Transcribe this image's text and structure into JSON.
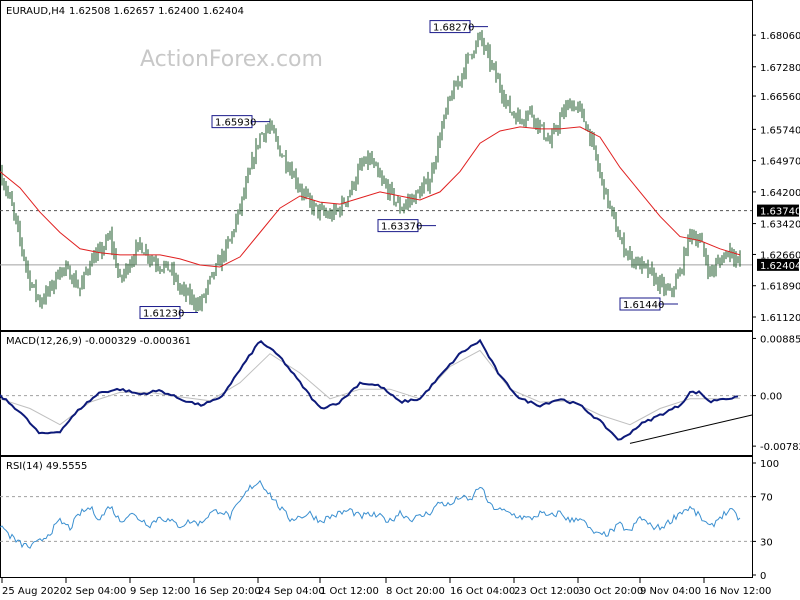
{
  "header": {
    "title": "EURAUD,H4",
    "ohlc": "1.62508 1.62657 1.62400 1.62404"
  },
  "watermark": "ActionForex.com",
  "colors": {
    "price": "#1e5a28",
    "ma": "#e02020",
    "macd": "#0d1a7a",
    "signal": "#c0c0c0",
    "rsi": "#3a8fd0",
    "callout_border": "#1a1a8a",
    "hline": "#555555",
    "trendline": "#000000"
  },
  "chart_data": [
    {
      "type": "candlestick",
      "name": "price",
      "title": "EURAUD,H4",
      "ylim": [
        1.608,
        1.689
      ],
      "yticks": [
        "1.68060",
        "1.67280",
        "1.66560",
        "1.65740",
        "1.64970",
        "1.64200",
        "1.63420",
        "1.62660",
        "1.61890",
        "1.61120"
      ],
      "ytick_values": [
        1.6806,
        1.6728,
        1.6656,
        1.6574,
        1.6497,
        1.642,
        1.6342,
        1.6266,
        1.6189,
        1.6112
      ],
      "xticks": [
        "25 Aug 2020",
        "2 Sep 04:00",
        "9 Sep 12:00",
        "16 Sep 20:00",
        "24 Sep 04:00",
        "1 Oct 12:00",
        "8 Oct 20:00",
        "16 Oct 04:00",
        "23 Oct 12:00",
        "30 Oct 20:00",
        "9 Nov 04:00",
        "16 Nov 12:00"
      ],
      "level_line": {
        "value": 1.6374,
        "label": "1.63740"
      },
      "current_price": {
        "value": 1.62404,
        "label": "1.62404"
      },
      "callouts": [
        {
          "label": "1.68270",
          "value": 1.6827
        },
        {
          "label": "1.65930",
          "value": 1.6593
        },
        {
          "label": "1.63370",
          "value": 1.6337
        },
        {
          "label": "1.61230",
          "value": 1.6123
        },
        {
          "label": "1.61440",
          "value": 1.6144
        }
      ],
      "close_path": [
        [
          0,
          1.647
        ],
        [
          10,
          1.64
        ],
        [
          20,
          1.63
        ],
        [
          30,
          1.62
        ],
        [
          40,
          1.615
        ],
        [
          50,
          1.618
        ],
        [
          60,
          1.623
        ],
        [
          70,
          1.622
        ],
        [
          80,
          1.618
        ],
        [
          90,
          1.625
        ],
        [
          100,
          1.627
        ],
        [
          110,
          1.631
        ],
        [
          120,
          1.62
        ],
        [
          130,
          1.625
        ],
        [
          140,
          1.629
        ],
        [
          150,
          1.626
        ],
        [
          160,
          1.624
        ],
        [
          170,
          1.623
        ],
        [
          180,
          1.618
        ],
        [
          190,
          1.616
        ],
        [
          200,
          1.614
        ],
        [
          210,
          1.62
        ],
        [
          220,
          1.625
        ],
        [
          230,
          1.63
        ],
        [
          240,
          1.638
        ],
        [
          250,
          1.647
        ],
        [
          260,
          1.656
        ],
        [
          270,
          1.658
        ],
        [
          280,
          1.652
        ],
        [
          290,
          1.648
        ],
        [
          300,
          1.643
        ],
        [
          310,
          1.639
        ],
        [
          320,
          1.637
        ],
        [
          330,
          1.636
        ],
        [
          340,
          1.638
        ],
        [
          350,
          1.642
        ],
        [
          360,
          1.648
        ],
        [
          370,
          1.65
        ],
        [
          380,
          1.645
        ],
        [
          390,
          1.642
        ],
        [
          400,
          1.638
        ],
        [
          410,
          1.64
        ],
        [
          420,
          1.642
        ],
        [
          430,
          1.645
        ],
        [
          440,
          1.656
        ],
        [
          450,
          1.665
        ],
        [
          460,
          1.67
        ],
        [
          470,
          1.676
        ],
        [
          480,
          1.68
        ],
        [
          490,
          1.674
        ],
        [
          500,
          1.668
        ],
        [
          510,
          1.662
        ],
        [
          520,
          1.66
        ],
        [
          530,
          1.662
        ],
        [
          540,
          1.658
        ],
        [
          550,
          1.654
        ],
        [
          560,
          1.66
        ],
        [
          570,
          1.664
        ],
        [
          580,
          1.662
        ],
        [
          590,
          1.656
        ],
        [
          600,
          1.646
        ],
        [
          610,
          1.638
        ],
        [
          620,
          1.63
        ],
        [
          630,
          1.626
        ],
        [
          640,
          1.624
        ],
        [
          650,
          1.622
        ],
        [
          660,
          1.619
        ],
        [
          670,
          1.617
        ],
        [
          680,
          1.622
        ],
        [
          690,
          1.632
        ],
        [
          700,
          1.63
        ],
        [
          710,
          1.622
        ],
        [
          720,
          1.625
        ],
        [
          730,
          1.628
        ],
        [
          740,
          1.624
        ]
      ],
      "ma_path": [
        [
          0,
          1.647
        ],
        [
          20,
          1.643
        ],
        [
          40,
          1.637
        ],
        [
          60,
          1.632
        ],
        [
          80,
          1.628
        ],
        [
          100,
          1.627
        ],
        [
          120,
          1.6265
        ],
        [
          140,
          1.6265
        ],
        [
          160,
          1.6265
        ],
        [
          180,
          1.6255
        ],
        [
          200,
          1.624
        ],
        [
          220,
          1.6235
        ],
        [
          240,
          1.626
        ],
        [
          260,
          1.632
        ],
        [
          280,
          1.638
        ],
        [
          300,
          1.641
        ],
        [
          320,
          1.6395
        ],
        [
          340,
          1.639
        ],
        [
          360,
          1.6405
        ],
        [
          380,
          1.642
        ],
        [
          400,
          1.641
        ],
        [
          420,
          1.64
        ],
        [
          440,
          1.642
        ],
        [
          460,
          1.647
        ],
        [
          480,
          1.654
        ],
        [
          500,
          1.657
        ],
        [
          520,
          1.658
        ],
        [
          540,
          1.6575
        ],
        [
          560,
          1.6575
        ],
        [
          580,
          1.658
        ],
        [
          600,
          1.6555
        ],
        [
          620,
          1.648
        ],
        [
          640,
          1.642
        ],
        [
          660,
          1.636
        ],
        [
          680,
          1.631
        ],
        [
          700,
          1.63
        ],
        [
          720,
          1.628
        ],
        [
          740,
          1.6265
        ]
      ]
    },
    {
      "type": "line",
      "name": "macd",
      "title": "MACD(12,26,9) -0.000329 -0.000361",
      "ylim": [
        -0.0092,
        0.0097
      ],
      "yticks": [
        "0.008859",
        "0.00",
        "-0.007826"
      ],
      "ytick_values": [
        0.008859,
        0.0,
        -0.007826
      ],
      "series": [
        {
          "values_path": [
            [
              0,
              0.0
            ],
            [
              20,
              -0.0025
            ],
            [
              40,
              -0.006
            ],
            [
              60,
              -0.0055
            ],
            [
              80,
              -0.002
            ],
            [
              100,
              0.0005
            ],
            [
              120,
              0.001
            ],
            [
              140,
              0.0002
            ],
            [
              160,
              0.0008
            ],
            [
              180,
              -0.0005
            ],
            [
              200,
              -0.0015
            ],
            [
              220,
              -0.0005
            ],
            [
              240,
              0.004
            ],
            [
              260,
              0.0085
            ],
            [
              280,
              0.006
            ],
            [
              300,
              0.002
            ],
            [
              320,
              -0.002
            ],
            [
              340,
              -0.001
            ],
            [
              360,
              0.002
            ],
            [
              380,
              0.0015
            ],
            [
              400,
              -0.001
            ],
            [
              420,
              -0.0005
            ],
            [
              440,
              0.003
            ],
            [
              460,
              0.0065
            ],
            [
              480,
              0.0085
            ],
            [
              500,
              0.003
            ],
            [
              520,
              -0.0005
            ],
            [
              540,
              -0.0015
            ],
            [
              560,
              -0.0005
            ],
            [
              580,
              -0.0015
            ],
            [
              600,
              -0.004
            ],
            [
              620,
              -0.007
            ],
            [
              640,
              -0.0045
            ],
            [
              660,
              -0.003
            ],
            [
              680,
              -0.0015
            ],
            [
              690,
              0.0005
            ],
            [
              700,
              0.0005
            ],
            [
              710,
              -0.001
            ],
            [
              720,
              -0.0005
            ],
            [
              740,
              -0.0003
            ]
          ]
        },
        {
          "values_path": [
            [
              0,
              -0.0005
            ],
            [
              30,
              -0.002
            ],
            [
              60,
              -0.0045
            ],
            [
              90,
              -0.001
            ],
            [
              120,
              0.0005
            ],
            [
              150,
              0.0005
            ],
            [
              180,
              -0.0002
            ],
            [
              210,
              -0.0008
            ],
            [
              240,
              0.002
            ],
            [
              270,
              0.0065
            ],
            [
              300,
              0.0035
            ],
            [
              330,
              -0.0005
            ],
            [
              360,
              0.001
            ],
            [
              390,
              0.001
            ],
            [
              420,
              -0.0005
            ],
            [
              450,
              0.0045
            ],
            [
              480,
              0.007
            ],
            [
              510,
              0.001
            ],
            [
              540,
              -0.001
            ],
            [
              570,
              -0.0008
            ],
            [
              600,
              -0.003
            ],
            [
              630,
              -0.0045
            ],
            [
              660,
              -0.002
            ],
            [
              690,
              -0.0005
            ],
            [
              720,
              -0.0005
            ],
            [
              740,
              -0.0004
            ]
          ]
        }
      ],
      "trendline": [
        [
          630,
          -0.0074
        ],
        [
          752,
          -0.003
        ]
      ]
    },
    {
      "type": "line",
      "name": "rsi",
      "title": "RSI(14) 49.5555",
      "ylim": [
        0,
        100
      ],
      "yticks": [
        "100",
        "70",
        "30",
        "0"
      ],
      "ytick_values": [
        100,
        70,
        30,
        0
      ],
      "levels": [
        70,
        30
      ],
      "values_path": [
        [
          0,
          45
        ],
        [
          10,
          35
        ],
        [
          20,
          28
        ],
        [
          30,
          25
        ],
        [
          40,
          30
        ],
        [
          50,
          38
        ],
        [
          60,
          48
        ],
        [
          70,
          42
        ],
        [
          80,
          55
        ],
        [
          90,
          60
        ],
        [
          100,
          50
        ],
        [
          110,
          62
        ],
        [
          120,
          48
        ],
        [
          130,
          55
        ],
        [
          140,
          50
        ],
        [
          150,
          45
        ],
        [
          160,
          52
        ],
        [
          170,
          48
        ],
        [
          180,
          44
        ],
        [
          190,
          48
        ],
        [
          200,
          46
        ],
        [
          210,
          55
        ],
        [
          220,
          58
        ],
        [
          230,
          52
        ],
        [
          240,
          65
        ],
        [
          250,
          78
        ],
        [
          260,
          84
        ],
        [
          270,
          72
        ],
        [
          280,
          60
        ],
        [
          290,
          50
        ],
        [
          300,
          52
        ],
        [
          310,
          55
        ],
        [
          320,
          48
        ],
        [
          330,
          52
        ],
        [
          340,
          55
        ],
        [
          350,
          58
        ],
        [
          360,
          52
        ],
        [
          370,
          54
        ],
        [
          380,
          52
        ],
        [
          390,
          48
        ],
        [
          400,
          56
        ],
        [
          410,
          50
        ],
        [
          420,
          52
        ],
        [
          430,
          56
        ],
        [
          440,
          65
        ],
        [
          450,
          62
        ],
        [
          460,
          70
        ],
        [
          470,
          66
        ],
        [
          480,
          80
        ],
        [
          490,
          62
        ],
        [
          500,
          58
        ],
        [
          510,
          55
        ],
        [
          520,
          52
        ],
        [
          530,
          50
        ],
        [
          540,
          55
        ],
        [
          550,
          52
        ],
        [
          560,
          56
        ],
        [
          570,
          48
        ],
        [
          580,
          52
        ],
        [
          590,
          40
        ],
        [
          600,
          35
        ],
        [
          610,
          38
        ],
        [
          620,
          45
        ],
        [
          630,
          38
        ],
        [
          640,
          52
        ],
        [
          650,
          44
        ],
        [
          660,
          42
        ],
        [
          670,
          48
        ],
        [
          680,
          56
        ],
        [
          690,
          60
        ],
        [
          700,
          52
        ],
        [
          710,
          42
        ],
        [
          720,
          52
        ],
        [
          730,
          58
        ],
        [
          740,
          50
        ]
      ]
    }
  ]
}
